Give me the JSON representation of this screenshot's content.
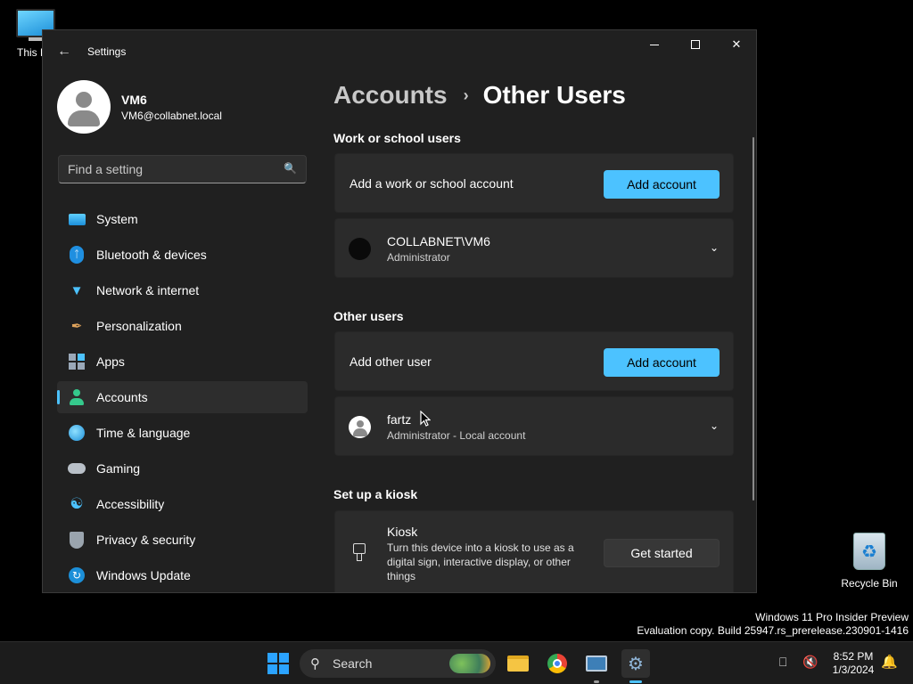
{
  "desktop": {
    "this_pc_label": "This P",
    "recycle_bin_label": "Recycle Bin",
    "watermark_line1": "Windows 11 Pro Insider Preview",
    "watermark_line2": "Evaluation copy. Build 25947.rs_prerelease.230901-1416"
  },
  "window": {
    "title": "Settings"
  },
  "profile": {
    "name": "VM6",
    "email": "VM6@collabnet.local"
  },
  "search": {
    "placeholder": "Find a setting"
  },
  "sidebar": {
    "items": [
      {
        "label": "System",
        "icon": "system-icon"
      },
      {
        "label": "Bluetooth & devices",
        "icon": "bluetooth-icon"
      },
      {
        "label": "Network & internet",
        "icon": "wifi-icon"
      },
      {
        "label": "Personalization",
        "icon": "brush-icon"
      },
      {
        "label": "Apps",
        "icon": "apps-icon"
      },
      {
        "label": "Accounts",
        "icon": "accounts-icon",
        "active": true
      },
      {
        "label": "Time & language",
        "icon": "globe-icon"
      },
      {
        "label": "Gaming",
        "icon": "gamepad-icon"
      },
      {
        "label": "Accessibility",
        "icon": "accessibility-icon"
      },
      {
        "label": "Privacy & security",
        "icon": "shield-icon"
      },
      {
        "label": "Windows Update",
        "icon": "update-icon"
      }
    ]
  },
  "breadcrumb": {
    "parent": "Accounts",
    "separator": "›",
    "current": "Other Users"
  },
  "work_school": {
    "section_title": "Work or school users",
    "add_text": "Add a work or school account",
    "add_button": "Add account",
    "user": {
      "name": "COLLABNET\\VM6",
      "role": "Administrator"
    }
  },
  "other_users": {
    "section_title": "Other users",
    "add_text": "Add other user",
    "add_button": "Add account",
    "user": {
      "name": "fartz",
      "role": "Administrator - Local account"
    }
  },
  "kiosk": {
    "section_title": "Set up a kiosk",
    "title": "Kiosk",
    "description": "Turn this device into a kiosk to use as a digital sign, interactive display, or other things",
    "button": "Get started"
  },
  "taskbar": {
    "search_label": "Search",
    "time": "8:52 PM",
    "date": "1/3/2024"
  },
  "colors": {
    "accent": "#4cc2ff",
    "window_bg": "#202020",
    "card_bg": "#2b2b2b"
  }
}
